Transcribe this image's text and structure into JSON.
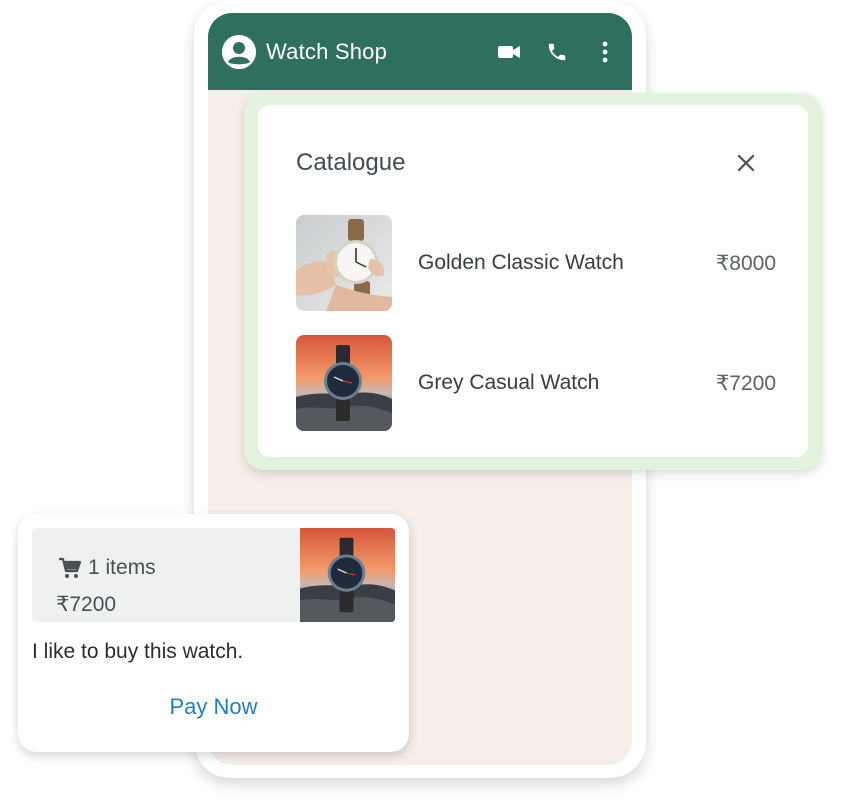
{
  "chat": {
    "title": "Watch Shop",
    "header_icons": [
      "video-call-icon",
      "phone-call-icon",
      "more-options-icon"
    ]
  },
  "catalogue": {
    "title": "Catalogue",
    "products": [
      {
        "name": "Golden Classic Watch",
        "price": "₹8000",
        "image": "watch-in-hand"
      },
      {
        "name": "Grey Casual Watch",
        "price": "₹7200",
        "image": "watch-on-rock-sunset"
      }
    ]
  },
  "message": {
    "item_count": "1 items",
    "total": "₹7200",
    "text": "I like to buy this watch.",
    "action": "Pay Now"
  },
  "colors": {
    "header": "#2e6f5f",
    "chat_background": "#f6eee8",
    "catalogue_frame": "#e3f3e0",
    "link": "#1f7fc2"
  }
}
